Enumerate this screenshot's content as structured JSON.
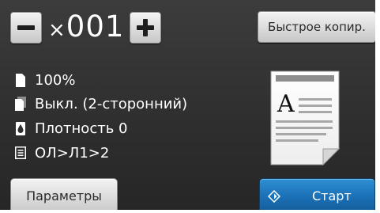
{
  "copies": {
    "prefix": "×",
    "value": "001",
    "minus_icon": "minus-icon",
    "plus_icon": "plus-icon"
  },
  "quick_copy_label": "Быстрое копир.",
  "settings": [
    {
      "icon": "page-size-icon",
      "text": "100%"
    },
    {
      "icon": "duplex-icon",
      "text": "Выкл. (2-сторонний)"
    },
    {
      "icon": "density-drop-icon",
      "text": "Плотность 0"
    },
    {
      "icon": "layout-list-icon",
      "text": "ОЛ>Л1>2"
    }
  ],
  "preview": {
    "letter": "A"
  },
  "params_label": "Параметры",
  "start_label": "Старт",
  "colors": {
    "screen_bg": "#333333",
    "start_button": "#1b6fb4",
    "button_face": "#d9d9d9",
    "text": "#ffffff"
  }
}
